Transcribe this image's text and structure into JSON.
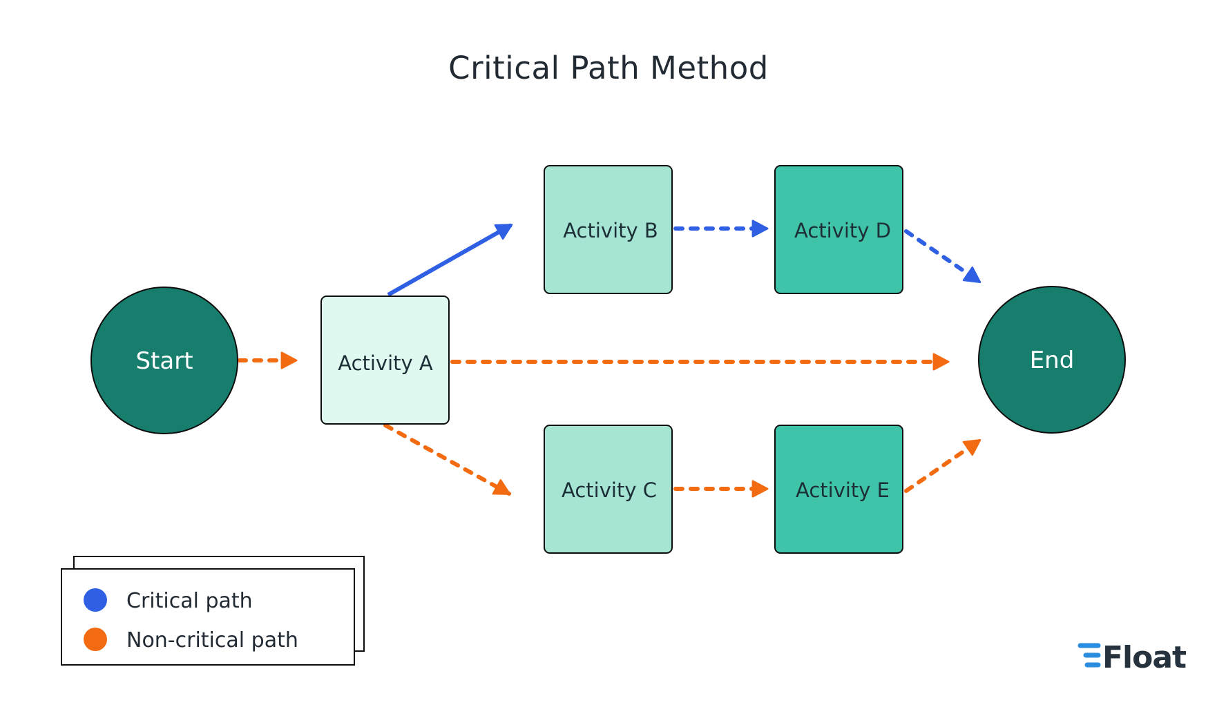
{
  "title": "Critical Path Method",
  "colors": {
    "critical": "#2f5fe3",
    "non_critical": "#f26b11",
    "terminal_fill": "#177d6c",
    "activity_a_fill": "#dff8f0",
    "activity_light_fill": "#a6e5d3",
    "activity_dark_fill": "#40c4a9",
    "node_stroke": "#0d0d0d",
    "logo_blue": "#2a8de0",
    "logo_text": "#26323d"
  },
  "nodes": {
    "start": {
      "label": "Start",
      "shape": "circle"
    },
    "end": {
      "label": "End",
      "shape": "circle"
    },
    "activity_a": {
      "label": "Activity A",
      "shape": "box"
    },
    "activity_b": {
      "label": "Activity B",
      "shape": "box"
    },
    "activity_c": {
      "label": "Activity C",
      "shape": "box"
    },
    "activity_d": {
      "label": "Activity D",
      "shape": "box"
    },
    "activity_e": {
      "label": "Activity E",
      "shape": "box"
    }
  },
  "edges": [
    {
      "from": "Start",
      "to": "Activity A",
      "path": "non-critical",
      "style": "dashed"
    },
    {
      "from": "Activity A",
      "to": "Activity B",
      "path": "critical",
      "style": "solid"
    },
    {
      "from": "Activity A",
      "to": "End",
      "path": "non-critical",
      "style": "dashed"
    },
    {
      "from": "Activity A",
      "to": "Activity C",
      "path": "non-critical",
      "style": "dashed"
    },
    {
      "from": "Activity B",
      "to": "Activity D",
      "path": "critical",
      "style": "dashed"
    },
    {
      "from": "Activity D",
      "to": "End",
      "path": "critical",
      "style": "dashed"
    },
    {
      "from": "Activity C",
      "to": "Activity E",
      "path": "non-critical",
      "style": "dashed"
    },
    {
      "from": "Activity E",
      "to": "End",
      "path": "non-critical",
      "style": "dashed"
    }
  ],
  "legend": {
    "items": [
      {
        "label": "Critical path",
        "color_key": "critical"
      },
      {
        "label": "Non-critical path",
        "color_key": "non_critical"
      }
    ]
  },
  "logo": {
    "text": "Float",
    "icon": "float-lines-icon"
  }
}
